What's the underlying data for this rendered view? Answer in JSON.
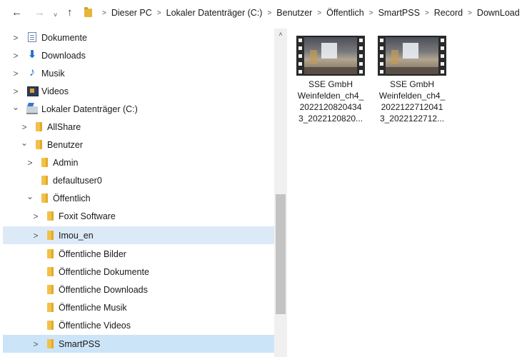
{
  "nav": {
    "back": "←",
    "forward": "→",
    "recent": "˅",
    "up": "↑"
  },
  "breadcrumb": [
    "Dieser PC",
    "Lokaler Datenträger (C:)",
    "Benutzer",
    "Öffentlich",
    "SmartPSS",
    "Record",
    "DownLoad"
  ],
  "tree": {
    "items": [
      {
        "label": "Dokumente",
        "chev": ">",
        "icon": "documents-icon"
      },
      {
        "label": "Downloads",
        "chev": ">",
        "icon": "download-icon"
      },
      {
        "label": "Musik",
        "chev": ">",
        "icon": "music-icon"
      },
      {
        "label": "Videos",
        "chev": ">",
        "icon": "videos-icon"
      },
      {
        "label": "Lokaler Datenträger (C:)",
        "chev": "⌄",
        "icon": "drive-icon"
      },
      {
        "label": "AllShare",
        "chev": ">",
        "icon": "folder-icon"
      },
      {
        "label": "Benutzer",
        "chev": "⌄",
        "icon": "folder-icon"
      },
      {
        "label": "Admin",
        "chev": ">",
        "icon": "folder-icon"
      },
      {
        "label": "defaultuser0",
        "chev": "",
        "icon": "folder-icon"
      },
      {
        "label": "Öffentlich",
        "chev": "⌄",
        "icon": "folder-icon"
      },
      {
        "label": "Foxit Software",
        "chev": ">",
        "icon": "folder-icon"
      },
      {
        "label": "Imou_en",
        "chev": ">",
        "icon": "folder-icon"
      },
      {
        "label": "Öffentliche Bilder",
        "chev": "",
        "icon": "folder-icon"
      },
      {
        "label": "Öffentliche Dokumente",
        "chev": "",
        "icon": "folder-icon"
      },
      {
        "label": "Öffentliche Downloads",
        "chev": "",
        "icon": "folder-icon"
      },
      {
        "label": "Öffentliche Musik",
        "chev": "",
        "icon": "folder-icon"
      },
      {
        "label": "Öffentliche Videos",
        "chev": "",
        "icon": "folder-icon"
      },
      {
        "label": "SmartPSS",
        "chev": ">",
        "icon": "folder-icon"
      }
    ]
  },
  "files": [
    {
      "name_lines": [
        "SSE GmbH",
        "Weinfelden_ch4_",
        "2022120820434",
        "3_2022120820..."
      ],
      "icon": "video-file-icon"
    },
    {
      "name_lines": [
        "SSE GmbH",
        "Weinfelden_ch4_",
        "2022122712041",
        "3_2022122712..."
      ],
      "icon": "video-file-icon"
    }
  ],
  "scrollbar": {
    "up_arrow": "˄"
  },
  "colors": {
    "hover": "#dceaf8",
    "selected": "#cce4f7",
    "folder": "#f0c24a"
  }
}
